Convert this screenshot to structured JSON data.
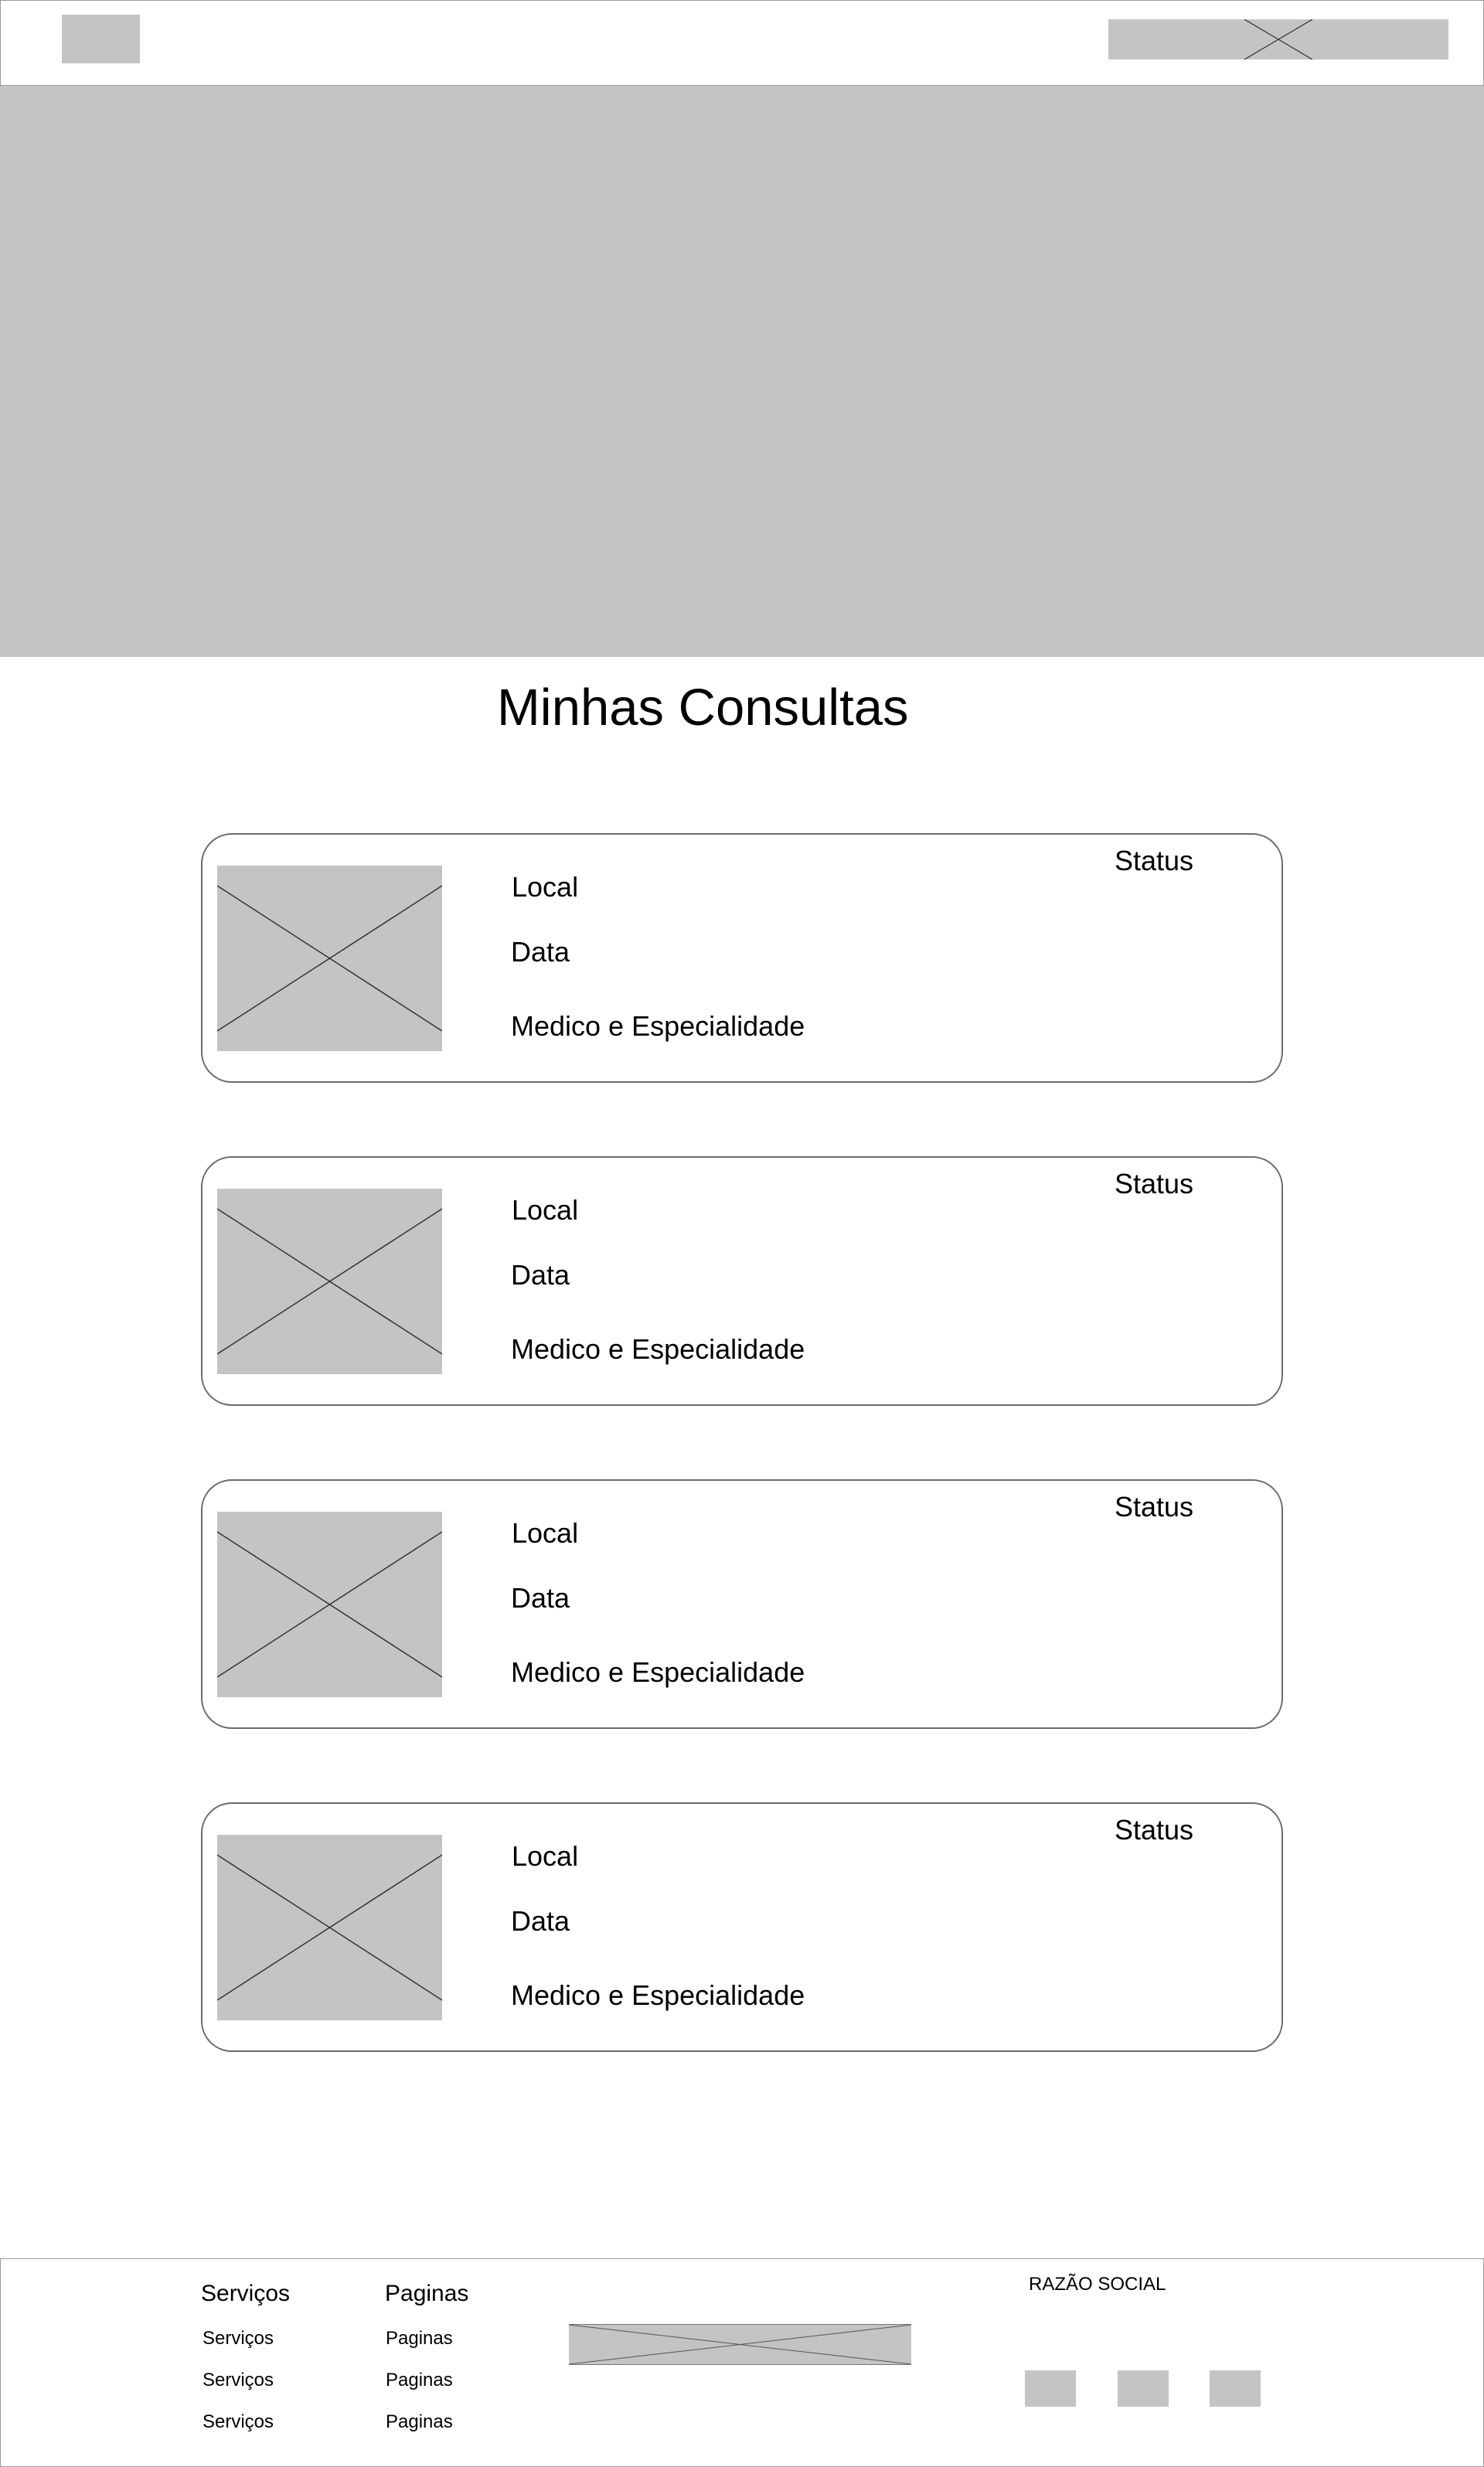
{
  "main": {
    "title": "Minhas Consultas"
  },
  "consultas": [
    {
      "local": "Local",
      "data": "Data",
      "medico": "Medico e Especialidade",
      "status": "Status"
    },
    {
      "local": "Local",
      "data": "Data",
      "medico": "Medico e Especialidade",
      "status": "Status"
    },
    {
      "local": "Local",
      "data": "Data",
      "medico": "Medico e Especialidade",
      "status": "Status"
    },
    {
      "local": "Local",
      "data": "Data",
      "medico": "Medico e Especialidade",
      "status": "Status"
    }
  ],
  "footer": {
    "servicos": {
      "heading": "Serviços",
      "links": [
        "Serviços",
        "Serviços",
        "Serviços"
      ]
    },
    "paginas": {
      "heading": "Paginas",
      "links": [
        "Paginas",
        "Paginas",
        "Paginas"
      ]
    },
    "razao_social": "RAZÃO SOCIAL"
  },
  "colors": {
    "placeholder": "#c4c4c4",
    "border": "#6b6b6b",
    "background": "#ffffff",
    "text": "#000000"
  }
}
